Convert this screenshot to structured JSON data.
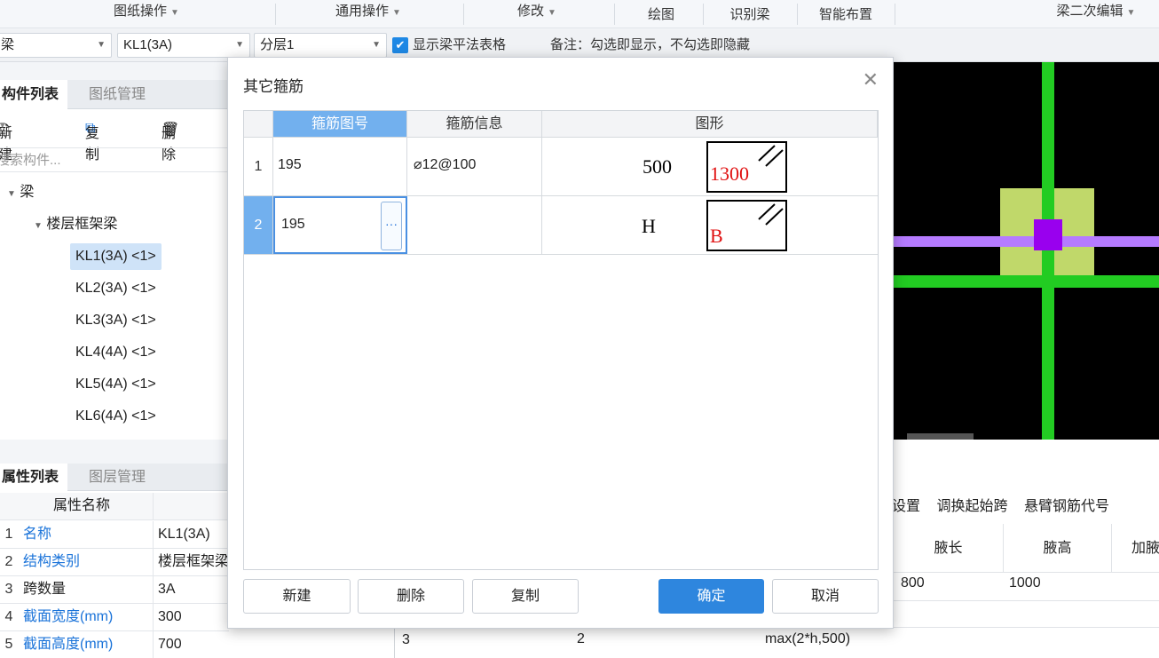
{
  "ribbon": {
    "groups": [
      "图纸操作",
      "通用操作",
      "修改",
      "绘图",
      "识别梁",
      "智能布置",
      "梁二次编辑"
    ]
  },
  "toolbar": {
    "combo1": "梁",
    "combo2": "KL1(3A)",
    "combo3": "分层1",
    "show_label": "显示梁平法表格",
    "note": "备注：勾选即显示，不勾选即隐藏"
  },
  "component_panel": {
    "tabs": [
      "构件列表",
      "图纸管理"
    ],
    "actions": {
      "new": "新建",
      "copy": "复制",
      "delete": "删除"
    },
    "search_placeholder": "搜索构件...",
    "tree_root": "梁",
    "tree_group": "楼层框架梁",
    "items": [
      "KL1(3A) <1>",
      "KL2(3A) <1>",
      "KL3(3A) <1>",
      "KL4(4A) <1>",
      "KL5(4A) <1>",
      "KL6(4A) <1>"
    ]
  },
  "property_panel": {
    "tabs": [
      "属性列表",
      "图层管理"
    ],
    "header_name": "属性名称",
    "rows": [
      {
        "idx": "1",
        "name": "名称",
        "value": "KL1(3A)"
      },
      {
        "idx": "2",
        "name": "结构类别",
        "value": "楼层框架梁"
      },
      {
        "idx": "3",
        "name": "跨数量",
        "value": "3A"
      },
      {
        "idx": "4",
        "name": "截面宽度(mm)",
        "value": "300"
      },
      {
        "idx": "5",
        "name": "截面高度(mm)",
        "value": "700"
      }
    ]
  },
  "bottom_table": {
    "toolbar_items": [
      "设置",
      "调换起始跨",
      "悬臂钢筋代号"
    ],
    "headers": [
      "腋长",
      "腋高",
      "加腋"
    ],
    "row1": [
      "800",
      "1000"
    ],
    "row3_idx": "3",
    "row3_cells": [
      "2",
      "max(2*h,500)"
    ]
  },
  "dialog": {
    "title": "其它箍筋",
    "columns": [
      "箍筋图号",
      "箍筋信息",
      "图形"
    ],
    "rows": [
      {
        "idx": "1",
        "code": "195",
        "info": "⌀12@100",
        "shape_left": "500",
        "shape_inner": "1300"
      },
      {
        "idx": "2",
        "code": "195",
        "info": "",
        "shape_left": "H",
        "shape_inner": "B"
      }
    ],
    "ellipsis": "···",
    "buttons": {
      "new": "新建",
      "delete": "删除",
      "copy": "复制",
      "ok": "确定",
      "cancel": "取消"
    }
  },
  "colors": {
    "accent": "#2e86de",
    "header_active": "#72b0ee",
    "cad_bg": "#000000",
    "cad_green": "#22cc22",
    "cad_purple": "#b57bff"
  }
}
